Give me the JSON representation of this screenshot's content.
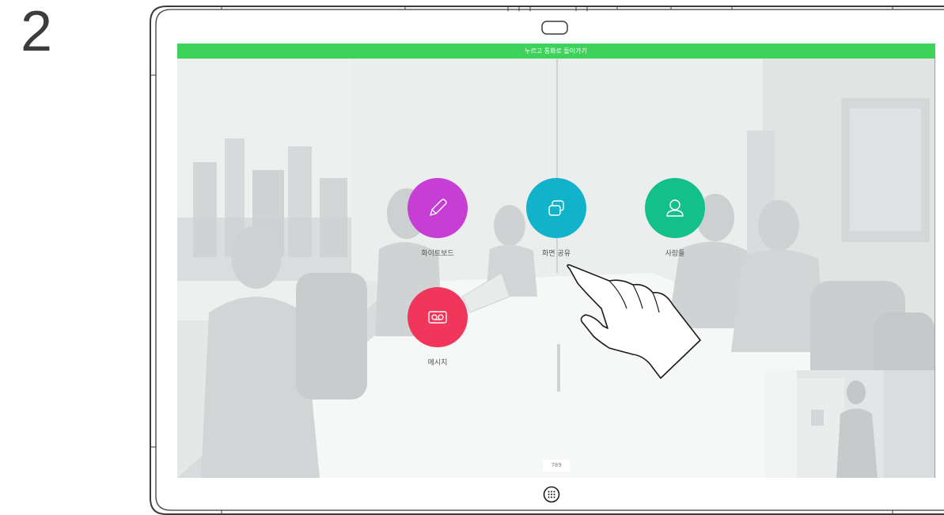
{
  "step": {
    "number": "2"
  },
  "banner": {
    "text": "누르고 통화로 돌아가기"
  },
  "actions": [
    {
      "label": "화이트보드",
      "icon": "pencil-icon",
      "color": "#c63ed4"
    },
    {
      "label": "화면 공유",
      "icon": "share-screen-icon",
      "color": "#10b3c9"
    },
    {
      "label": "사람들",
      "icon": "person-icon",
      "color": "#14c08a"
    },
    {
      "label": "메시지",
      "icon": "voicemail-icon",
      "color": "#f1365b"
    }
  ],
  "room": {
    "number": "789"
  },
  "colors": {
    "banner": "#3ed25a",
    "outline": "#3c3c3c"
  }
}
